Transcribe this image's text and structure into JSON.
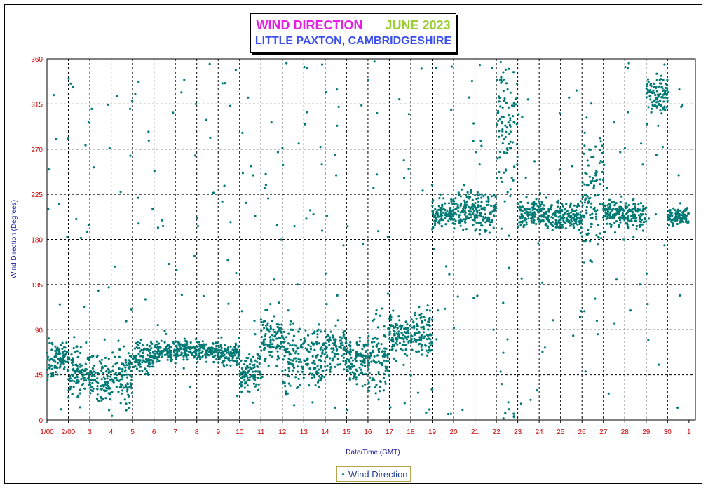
{
  "title": {
    "main": "WIND DIRECTION",
    "month": "JUNE 2023",
    "location": "LITTLE PAXTON, CAMBRIDGESHIRE",
    "colors": {
      "main": "#e61ee6",
      "month": "#9acd32",
      "location": "#3a4ff0"
    }
  },
  "chart_data": {
    "type": "scatter",
    "title": "WIND DIRECTION JUNE 2023",
    "subtitle": "LITTLE PAXTON, CAMBRIDGESHIRE",
    "xlabel": "Date/Time (GMT)",
    "ylabel": "Wind Direction (Degrees)",
    "ylim": [
      0,
      360
    ],
    "xlim": [
      0,
      30.3
    ],
    "yticks": [
      "0",
      "45",
      "90",
      "135",
      "180",
      "225",
      "270",
      "315",
      "360"
    ],
    "xticks": [
      "1/00",
      "2/00",
      "3",
      "4",
      "5",
      "6",
      "7",
      "8",
      "9",
      "10",
      "11",
      "12",
      "13",
      "14",
      "15",
      "16",
      "17",
      "18",
      "19",
      "20",
      "21",
      "22",
      "23",
      "24",
      "25",
      "26",
      "27",
      "28",
      "29",
      "30",
      "1"
    ],
    "grid": true,
    "legend_position": "bottom-center",
    "series": [
      {
        "name": "Wind Direction",
        "color": "#007a74",
        "daily_cluster_means": [
          62,
          48,
          40,
          42,
          62,
          68,
          70,
          70,
          66,
          50,
          80,
          60,
          65,
          70,
          60,
          62,
          85,
          88,
          205,
          210,
          208,
          300,
          205,
          205,
          203,
          230,
          205,
          205,
          325,
          203
        ],
        "daily_spread": [
          15,
          20,
          22,
          25,
          12,
          8,
          8,
          8,
          10,
          18,
          25,
          30,
          25,
          18,
          20,
          30,
          18,
          20,
          12,
          15,
          15,
          60,
          12,
          12,
          12,
          60,
          12,
          12,
          15,
          8
        ]
      }
    ]
  },
  "legend": {
    "label": "Wind Direction"
  }
}
